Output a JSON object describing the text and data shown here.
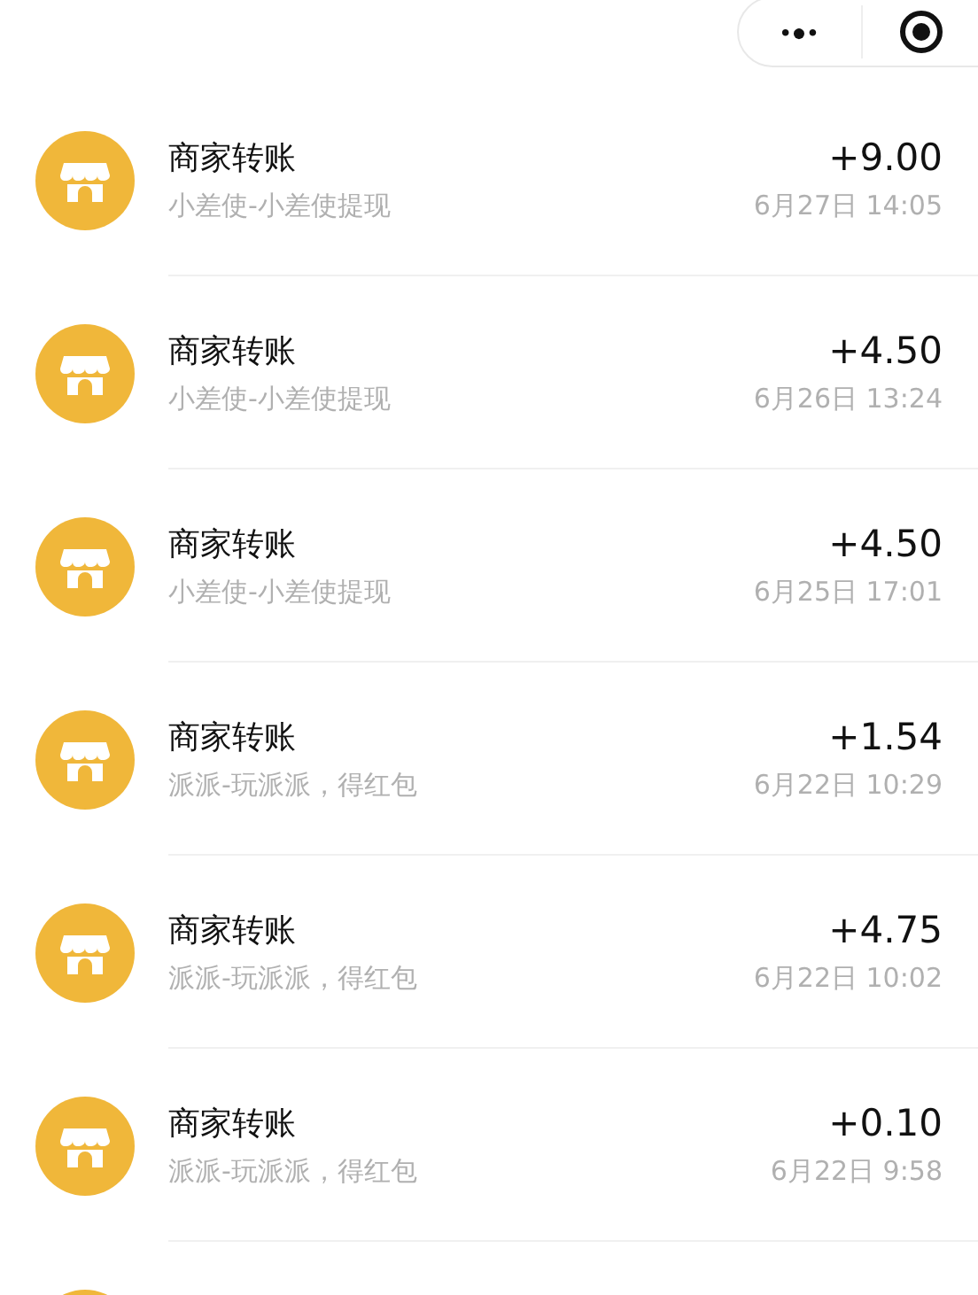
{
  "capsule": {
    "menu": "•●•"
  },
  "transactions": [
    {
      "kind": "full",
      "title": "商家转账",
      "subtitle": "小差使-小差使提现",
      "amount": "+9.00",
      "time": "6月27日 14:05"
    },
    {
      "kind": "full",
      "title": "商家转账",
      "subtitle": "小差使-小差使提现",
      "amount": "+4.50",
      "time": "6月26日 13:24"
    },
    {
      "kind": "full",
      "title": "商家转账",
      "subtitle": "小差使-小差使提现",
      "amount": "+4.50",
      "time": "6月25日 17:01"
    },
    {
      "kind": "full",
      "title": "商家转账",
      "subtitle": "派派-玩派派，得红包",
      "amount": "+1.54",
      "time": "6月22日 10:29"
    },
    {
      "kind": "full",
      "title": "商家转账",
      "subtitle": "派派-玩派派，得红包",
      "amount": "+4.75",
      "time": "6月22日 10:02"
    },
    {
      "kind": "full",
      "title": "商家转账",
      "subtitle": "派派-玩派派，得红包",
      "amount": "+0.10",
      "time": "6月22日 9:58"
    },
    {
      "kind": "peek"
    }
  ]
}
